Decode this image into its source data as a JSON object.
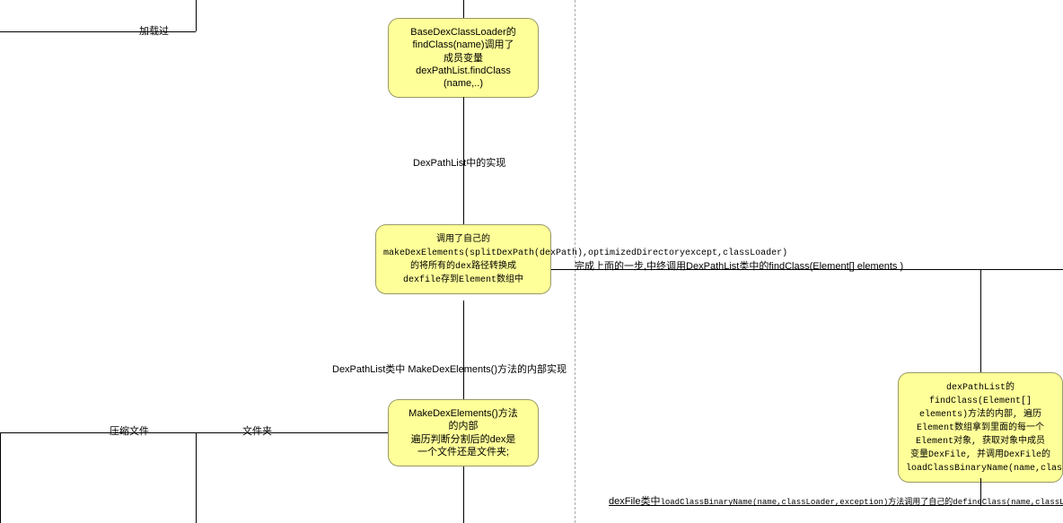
{
  "nodes": {
    "n1": "BaseDexClassLoader的\nfindClass(name)调用了\n成员变量\ndexPathList.findClass\n(name,..)",
    "n2": "调用了自己的\nmakeDexElements(splitDexPath(dexPath),optimizedDirectoryexcept,classLoader)的将所有的dex路径转换成\ndexfile存到Element数组中",
    "n3": "MakeDexElements()方法\n的内部\n遍历判断分割后的dex是\n一个文件还是文件夹;",
    "n4": "dexPathList的\nfindClass(Element[]\nelements)方法的内部, 遍历\nElement数组拿到里面的每一个\nElement对象, 获取对象中成员\n变量DexFile, 并调用DexFile的\nloadClassBinaryName(name,classLoader,exception)"
  },
  "labels": {
    "l1": "加载过",
    "l2": "DexPathList中的实现",
    "l3": "完成上面的一步,中终调用DexPathList类中的findClass(Element[] elements )",
    "l4": "DexPathList类中 MakeDexElements()方法的内部实现",
    "l5": "压缩文件",
    "l6": "文件夹",
    "l7_a": "dexFile类中",
    "l7_b": "loadClassBinaryName(name,classLoader,exception)方法调用了自己的defineClass(name,classLoader,coo"
  }
}
